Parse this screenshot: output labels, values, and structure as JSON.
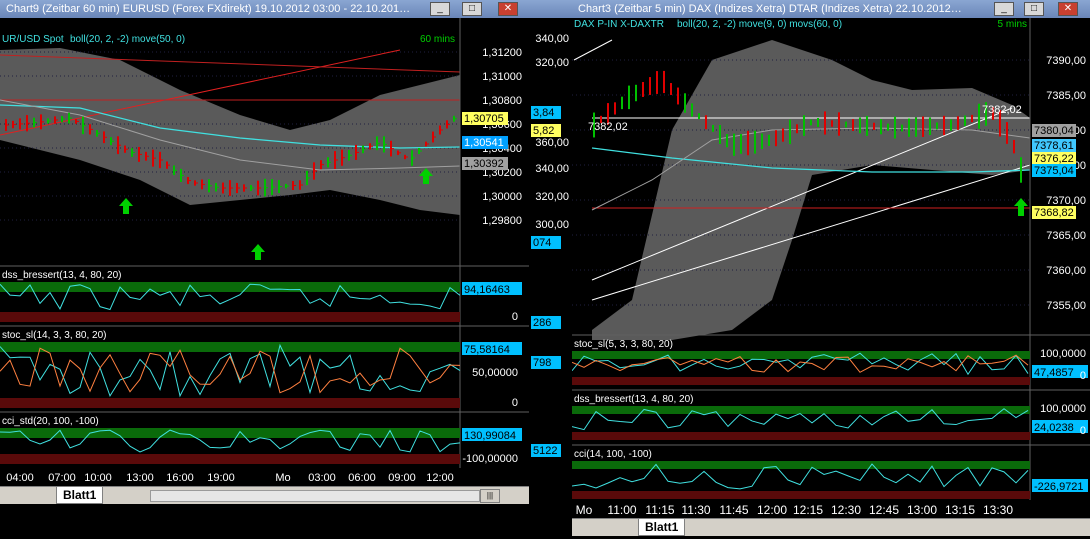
{
  "left_window": {
    "title": "Chart9 (Zeitbar 60 min)  EURUSD (Forex FXdirekt) 19.10.2012 03:00 - 22.10.201…",
    "instrument_label": "UR/USD Spot",
    "indicator_label": "boll(20, 2, -2)  move(50, 0)",
    "timeframe_label": "60 mins",
    "price_ticks": [
      "1,31200",
      "1,31000",
      "1,30800",
      "1,30600",
      "1,30400",
      "1,30200",
      "1,30000",
      "1,29800"
    ],
    "price_tags": [
      {
        "text": "1,30705",
        "bg": "#ffff60",
        "fg": "#000"
      },
      {
        "text": "1,30541",
        "bg": "#00a0ff",
        "fg": "#fff"
      },
      {
        "text": "1,30392",
        "bg": "#a0a0a0",
        "fg": "#000"
      }
    ],
    "panels": [
      {
        "label": "dss_bressert(13, 4, 80, 20)",
        "tag": "94,16463",
        "tag_bg": "#00c0ff",
        "ticks": [
          "0"
        ]
      },
      {
        "label": "stoc_sl(14, 3, 3, 80, 20)",
        "tag": "75,58164",
        "tag_bg": "#00c0ff",
        "ticks": [
          "50,00000",
          "0"
        ]
      },
      {
        "label": "cci_std(20, 100, -100)",
        "tag": "130,99084",
        "tag_bg": "#00c0ff",
        "ticks": [
          "-100,00000"
        ]
      }
    ],
    "time_axis": [
      "04:00",
      "07:00",
      "10:00",
      "13:00",
      "16:00",
      "19:00",
      "Mo",
      "03:00",
      "06:00",
      "09:00",
      "12:00"
    ],
    "sheet_tab": "Blatt1"
  },
  "middle_strip": {
    "ticks": [
      "340,00",
      "320,00",
      "360,00",
      "340,00",
      "320,00",
      "300,00"
    ],
    "tags": [
      "3,84",
      "5,82",
      "074",
      "286",
      "798",
      "5122"
    ]
  },
  "right_window": {
    "title": "Chart3 (Zeitbar 5 min)  DAX (Indizes Xetra) DTAR (Indizes Xetra) 22.10.2012…",
    "instrument_label": "DAX P-IN  X-DAXTR",
    "indicator_label": "boll(20, 2, -2)  move(9, 0)  movs(60, 0)",
    "timeframe_label": "5 mins",
    "price_ticks": [
      "7390,00",
      "7385,00",
      "7380,00",
      "7375,00",
      "7370,00",
      "7365,00",
      "7360,00",
      "7355,00"
    ],
    "price_tags": [
      {
        "text": "7380,04",
        "bg": "#a0a0a0",
        "fg": "#000"
      },
      {
        "text": "7378,61",
        "bg": "#40c8ff",
        "fg": "#000"
      },
      {
        "text": "7376,22",
        "bg": "#ffff60",
        "fg": "#000"
      },
      {
        "text": "7375,04",
        "bg": "#00c0ff",
        "fg": "#000"
      },
      {
        "text": "7368,82",
        "bg": "#ffff60",
        "fg": "#000"
      }
    ],
    "annotations": [
      "7382,02",
      "7382,02"
    ],
    "panels": [
      {
        "label": "stoc_sl(5, 3, 3, 80, 20)",
        "tag": "47,4857",
        "tag_bg": "#00c0ff",
        "ticks": [
          "100,0000",
          "0"
        ]
      },
      {
        "label": "dss_bressert(13, 4, 80, 20)",
        "tag": "24,0238",
        "tag_bg": "#00c0ff",
        "ticks": [
          "100,0000",
          "0"
        ]
      },
      {
        "label": "cci(14, 100, -100)",
        "tag": "-226,9721",
        "tag_bg": "#00c0ff",
        "ticks": []
      }
    ],
    "time_axis": [
      "Mo",
      "11:00",
      "11:15",
      "11:30",
      "11:45",
      "12:00",
      "12:15",
      "12:30",
      "12:45",
      "13:00",
      "13:15",
      "13:30"
    ],
    "sheet_tab": "Blatt1"
  },
  "colors": {
    "band": "#5a5a5a",
    "grid": "#202040",
    "up": "#00c000",
    "down": "#e00000",
    "accent": "#40e0e0"
  }
}
